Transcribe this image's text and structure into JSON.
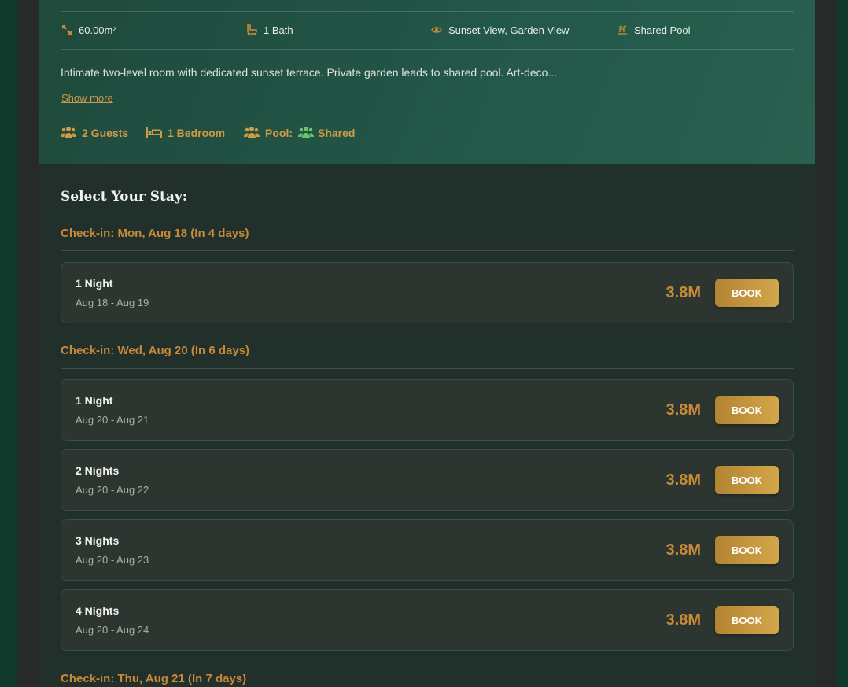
{
  "amenities": {
    "area": "60.00m²",
    "bath": "1 Bath",
    "view": "Sunset View, Garden View",
    "pool": "Shared Pool"
  },
  "description": "Intimate two-level room with dedicated sunset terrace. Private garden leads to shared pool. Art-deco...",
  "show_more": "Show more",
  "meta": {
    "guests": "2 Guests",
    "bedrooms": "1 Bedroom",
    "pool_label": "Pool:",
    "pool_value": "Shared"
  },
  "select_title": "Select Your Stay:",
  "checkins": [
    {
      "label": "Check-in: Mon, Aug 18 (In 4 days)",
      "options": [
        {
          "nights": "1 Night",
          "dates": "Aug 18 - Aug 19",
          "price": "3.8M",
          "button": "BOOK"
        }
      ]
    },
    {
      "label": "Check-in: Wed, Aug 20 (In 6 days)",
      "options": [
        {
          "nights": "1 Night",
          "dates": "Aug 20 - Aug 21",
          "price": "3.8M",
          "button": "BOOK"
        },
        {
          "nights": "2 Nights",
          "dates": "Aug 20 - Aug 22",
          "price": "3.8M",
          "button": "BOOK"
        },
        {
          "nights": "3 Nights",
          "dates": "Aug 20 - Aug 23",
          "price": "3.8M",
          "button": "BOOK"
        },
        {
          "nights": "4 Nights",
          "dates": "Aug 20 - Aug 24",
          "price": "3.8M",
          "button": "BOOK"
        }
      ]
    },
    {
      "label": "Check-in: Thu, Aug 21 (In 7 days)",
      "options": []
    }
  ],
  "colors": {
    "accent_gold": "#c98a36",
    "pool_green": "#6ac46a",
    "header_green": "#23584a"
  }
}
